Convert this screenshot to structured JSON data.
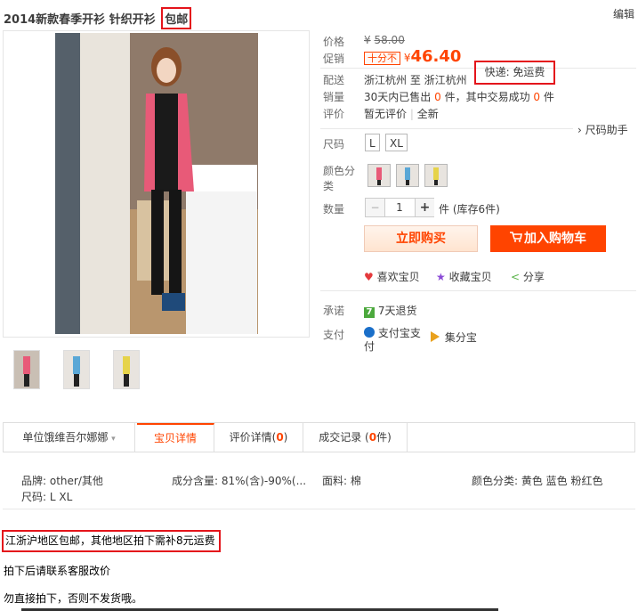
{
  "title": {
    "text": "2014新款春季开衫 针织开衫",
    "tag": "包邮"
  },
  "edit_label": "编辑",
  "price": {
    "label": "价格",
    "currency": "¥",
    "original": "58.00"
  },
  "promo": {
    "label": "促销",
    "tag": "十分不",
    "currency": "¥",
    "value": "46.40"
  },
  "shipping": {
    "label": "配送",
    "text": "浙江杭州 至 浙江杭州",
    "express": "快递: 免运费"
  },
  "sales": {
    "label": "销量",
    "prefix": "30天内已售出",
    "count": "0",
    "mid": "件，其中交易成功",
    "success": "0",
    "suffix": "件"
  },
  "review": {
    "label": "评价",
    "text": "暂无评价",
    "sep": "|",
    "tag": "全新"
  },
  "size_helper": "› 尺码助手",
  "size": {
    "label": "尺码",
    "options": [
      "L",
      "XL"
    ]
  },
  "color": {
    "label": "颜色分类",
    "options": [
      "粉红色",
      "蓝色",
      "黄色"
    ]
  },
  "quantity": {
    "label": "数量",
    "minus": "−",
    "value": "1",
    "plus": "+",
    "unit": "件 (库存6件)"
  },
  "buttons": {
    "buy": "立即购买",
    "cart": "加入购物车"
  },
  "social": {
    "like": "喜欢宝贝",
    "collect": "收藏宝贝",
    "share": "分享"
  },
  "promise": {
    "label": "承诺",
    "badge": "7",
    "text": "7天退货"
  },
  "payment": {
    "label": "支付",
    "alipay_line1": "支付宝支",
    "alipay_line2": "付",
    "jifen": "集分宝"
  },
  "tabs": {
    "shop": "单位饿维吾尔娜娜",
    "details": "宝贝详情",
    "reviews_label": "评价详情(",
    "reviews_count": "0",
    "reviews_close": ")",
    "records_label": "成交记录 (",
    "records_count": "0",
    "records_close": "件)"
  },
  "attributes": {
    "brand": "品牌: other/其他",
    "composition": "成分含量: 81%(含)-90%(...",
    "fabric": "面料: 棉",
    "color": "颜色分类: 黄色 蓝色 粉红色",
    "size": "尺码: L XL"
  },
  "description": [
    "江浙沪地区包邮，其他地区拍下需补8元运费",
    "拍下后请联系客服改价",
    "勿直接拍下，否则不发货哦。"
  ],
  "colors": {
    "accent": "#ff4400",
    "highlight": "#e4141b"
  }
}
